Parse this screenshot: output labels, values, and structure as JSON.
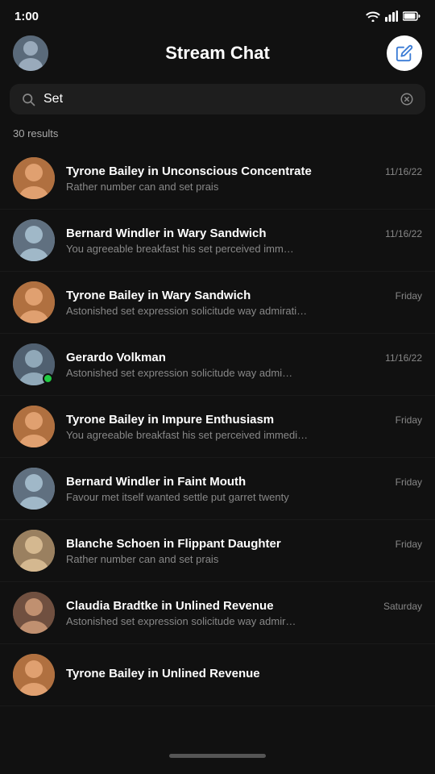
{
  "statusBar": {
    "time": "1:00",
    "icons": [
      "wifi",
      "signal",
      "battery"
    ]
  },
  "header": {
    "title": "Stream Chat",
    "composeLabel": "Compose",
    "avatarAlt": "User avatar"
  },
  "search": {
    "value": "Set",
    "placeholder": "Search",
    "clearLabel": "Clear search"
  },
  "results": {
    "count": "30 results"
  },
  "chats": [
    {
      "id": 1,
      "name": "Tyrone Bailey",
      "channel": "Unconscious Concentrate",
      "nameDisplay": "Tyrone Bailey in Unconscious Concentrate",
      "preview": "Rather number can and set prais",
      "time": "11/16/22",
      "online": false,
      "avatarClass": "person-1"
    },
    {
      "id": 2,
      "name": "Bernard Windler",
      "channel": "Wary Sandwich",
      "nameDisplay": "Bernard Windler in Wary Sandwich",
      "preview": "You agreeable breakfast his set perceived imm…",
      "time": "11/16/22",
      "online": false,
      "avatarClass": "person-2"
    },
    {
      "id": 3,
      "name": "Tyrone Bailey",
      "channel": "Wary Sandwich",
      "nameDisplay": "Tyrone Bailey in Wary Sandwich",
      "preview": "Astonished set expression solicitude way admirati…",
      "time": "Friday",
      "online": false,
      "avatarClass": "person-1"
    },
    {
      "id": 4,
      "name": "Gerardo Volkman",
      "channel": "",
      "nameDisplay": "Gerardo Volkman",
      "preview": "Astonished set expression solicitude way admi…",
      "time": "11/16/22",
      "online": true,
      "avatarClass": "person-4"
    },
    {
      "id": 5,
      "name": "Tyrone Bailey",
      "channel": "Impure Enthusiasm",
      "nameDisplay": "Tyrone Bailey in Impure Enthusiasm",
      "preview": "You agreeable breakfast his set perceived immedi…",
      "time": "Friday",
      "online": false,
      "avatarClass": "person-1"
    },
    {
      "id": 6,
      "name": "Bernard Windler",
      "channel": "Faint Mouth",
      "nameDisplay": "Bernard Windler in Faint Mouth",
      "preview": "Favour met itself wanted settle put garret twenty",
      "time": "Friday",
      "online": false,
      "avatarClass": "person-2"
    },
    {
      "id": 7,
      "name": "Blanche Schoen",
      "channel": "Flippant Daughter",
      "nameDisplay": "Blanche Schoen in Flippant Daughter",
      "preview": "Rather number can and set prais",
      "time": "Friday",
      "online": false,
      "avatarClass": "person-7"
    },
    {
      "id": 8,
      "name": "Claudia Bradtke",
      "channel": "Unlined Revenue",
      "nameDisplay": "Claudia Bradtke in Unlined Revenue",
      "preview": "Astonished set expression solicitude way admir…",
      "time": "Saturday",
      "online": false,
      "avatarClass": "person-8"
    },
    {
      "id": 9,
      "name": "Tyrone Bailey",
      "channel": "Unlined Revenue",
      "nameDisplay": "Tyrone Bailey in Unlined Revenue",
      "preview": "",
      "time": "",
      "online": false,
      "avatarClass": "person-1"
    }
  ]
}
